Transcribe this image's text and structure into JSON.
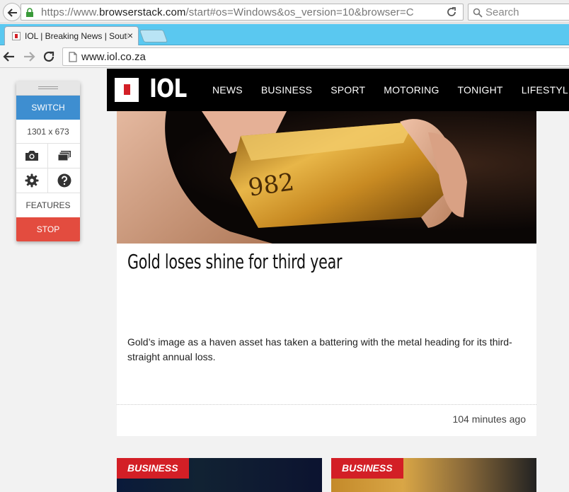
{
  "outer_browser": {
    "url_prefix": "https://www.",
    "url_domain": "browserstack.com",
    "url_rest": "/start#os=Windows&os_version=10&browser=C",
    "search_placeholder": "Search"
  },
  "inner_browser": {
    "tab_title": "IOL | Breaking News | South",
    "tab_close": "×",
    "address": "www.iol.co.za"
  },
  "browserstack_panel": {
    "switch_label": "SWITCH",
    "resolution": "1301 x 673",
    "features_label": "FEATURES",
    "stop_label": "STOP",
    "icons": [
      "camera-icon",
      "screens-icon",
      "settings-icon",
      "help-icon"
    ]
  },
  "site": {
    "logo_text": "IOL",
    "nav": [
      "NEWS",
      "BUSINESS",
      "SPORT",
      "MOTORING",
      "TONIGHT",
      "LIFESTYLE"
    ]
  },
  "article": {
    "headline": "Gold loses shine for third year",
    "summary": "Gold’s image as a haven asset has taken a battering with the metal heading for its third-straight annual loss.",
    "timestamp": "104 minutes ago",
    "image_text": "982"
  },
  "lower_cards": [
    {
      "category": "BUSINESS"
    },
    {
      "category": "BUSINESS"
    }
  ],
  "colors": {
    "brand_red": "#d31f26",
    "switch_blue": "#3e8ed0",
    "stop_red": "#e34c3f",
    "tab_strip": "#5ac8f0"
  }
}
